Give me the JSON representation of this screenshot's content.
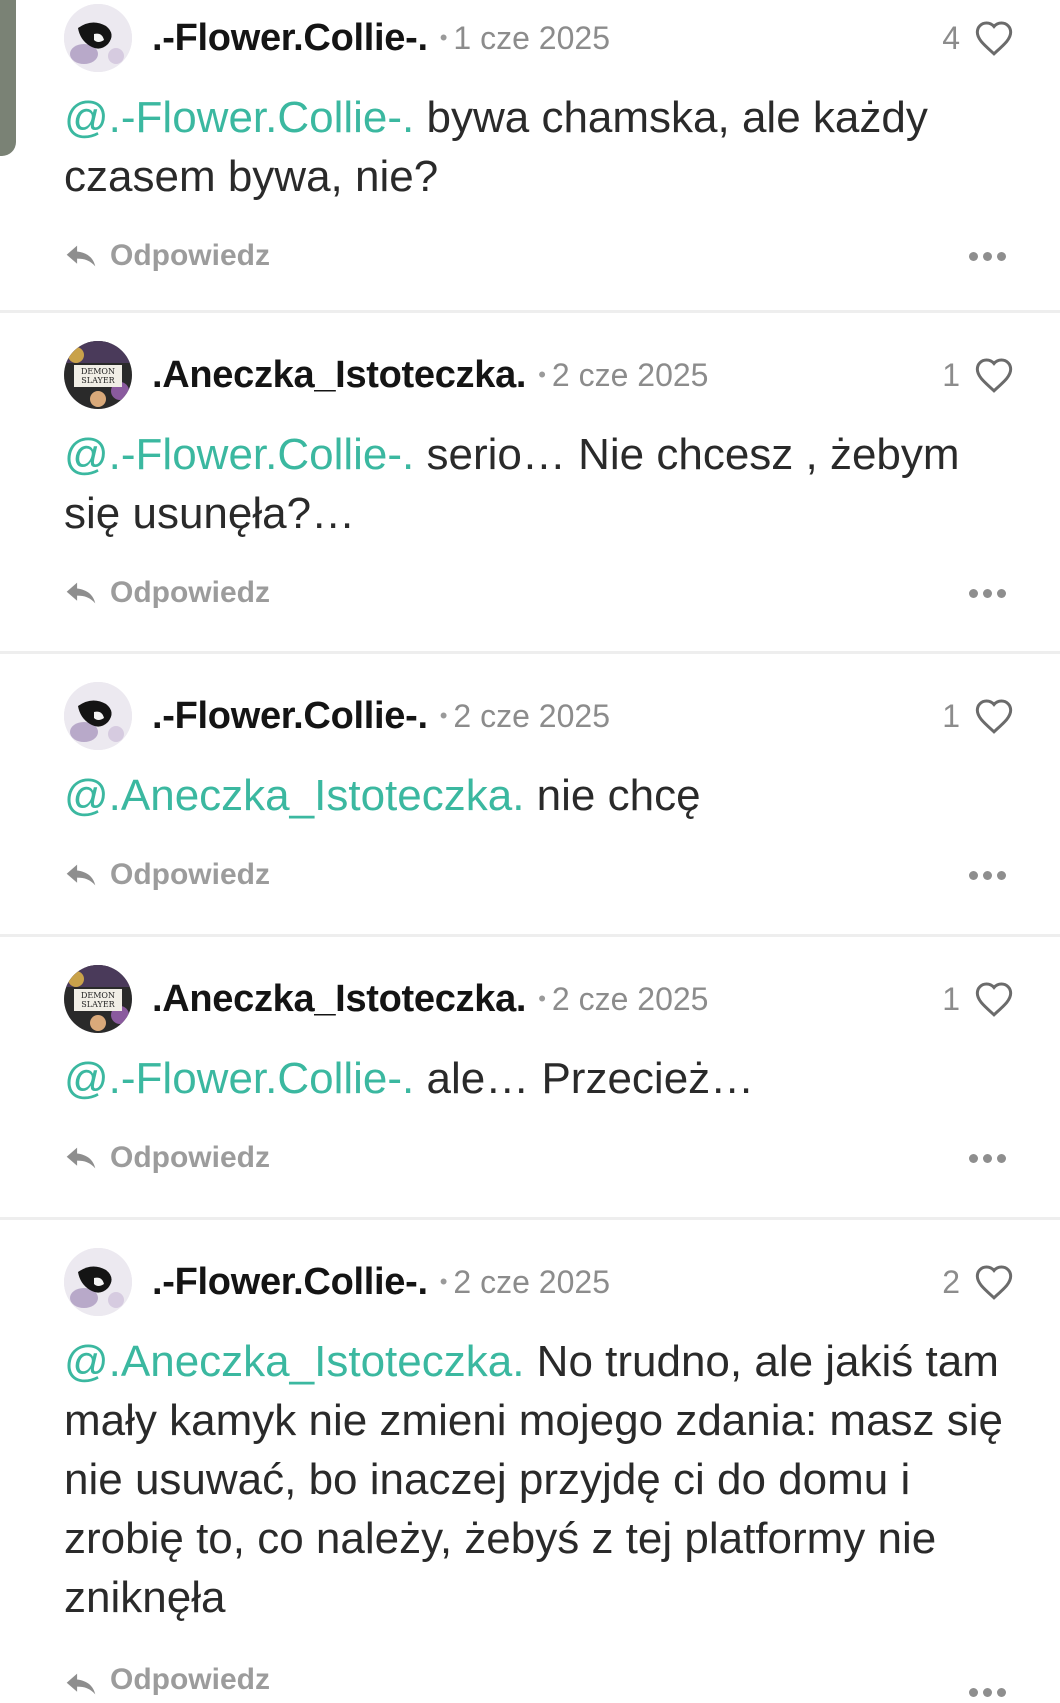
{
  "reply_label": "Odpowiedz",
  "colors": {
    "mention": "#3bb8a0",
    "meta": "#8c8c8c"
  },
  "comments": [
    {
      "username": ".-Flower.Collie-.",
      "date": "1 cze 2025",
      "likes": "4",
      "mention": "@.-Flower.Collie-.",
      "text": " bywa chamska, ale każdy czasem bywa, nie?",
      "avatar": "collie-avatar"
    },
    {
      "username": ".Aneczka_Istoteczka.",
      "date": "2 cze 2025",
      "likes": "1",
      "mention": "@.-Flower.Collie-.",
      "text": " serio… Nie chcesz , żebym się usunęła?…",
      "avatar": "demon-slayer-avatar"
    },
    {
      "username": ".-Flower.Collie-.",
      "date": "2 cze 2025",
      "likes": "1",
      "mention": "@.Aneczka_Istoteczka.",
      "text": " nie chcę",
      "avatar": "collie-avatar"
    },
    {
      "username": ".Aneczka_Istoteczka.",
      "date": "2 cze 2025",
      "likes": "1",
      "mention": "@.-Flower.Collie-.",
      "text": " ale… Przecież…",
      "avatar": "demon-slayer-avatar"
    },
    {
      "username": ".-Flower.Collie-.",
      "date": "2 cze 2025",
      "likes": "2",
      "mention": "@.Aneczka_Istoteczka.",
      "text": " No trudno, ale jakiś tam mały kamyk nie zmieni mojego zdania: masz się nie usuwać, bo inaczej przyjdę ci do domu i zrobię to, co należy, żebyś z tej platformy nie zniknęła",
      "avatar": "collie-avatar"
    }
  ]
}
